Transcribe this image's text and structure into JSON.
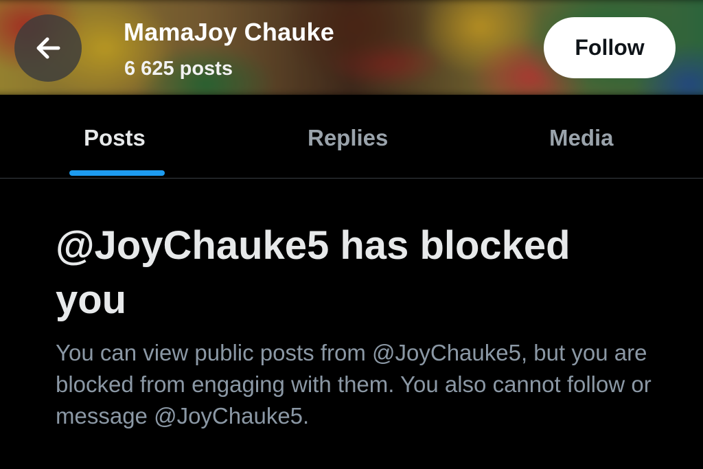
{
  "header": {
    "profile_name": "MamaJoy Chauke",
    "post_count": "6 625 posts",
    "follow_label": "Follow",
    "back_icon": "arrow-left-icon"
  },
  "tabs": [
    {
      "label": "Posts",
      "active": true
    },
    {
      "label": "Replies",
      "active": false
    },
    {
      "label": "Media",
      "active": false
    }
  ],
  "blocked": {
    "title": "@JoyChauke5 has blocked you",
    "message": "You can view public posts from @JoyChauke5, but you are blocked from engaging with them. You also cannot follow or message @JoyChauke5."
  },
  "colors": {
    "background": "#000000",
    "accent": "#1d9bf0",
    "primary_text": "#e7e9ea",
    "secondary_text": "#8b98a5",
    "follow_button_bg": "#ffffff"
  }
}
